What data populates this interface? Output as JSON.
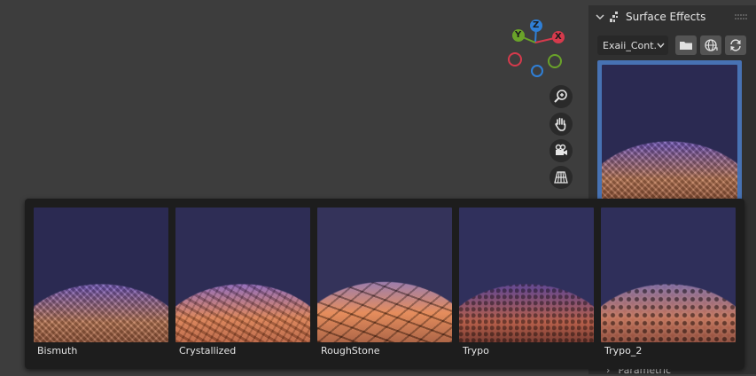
{
  "gizmo": {
    "z_label": "Z",
    "y_label": "Y",
    "x_label": "X",
    "colors": {
      "z": "#2f7fd6",
      "y": "#6aa329",
      "x": "#d63a4c"
    }
  },
  "view_tools": [
    {
      "name": "zoom-icon"
    },
    {
      "name": "pan-hand-icon"
    },
    {
      "name": "camera-icon"
    },
    {
      "name": "perspective-grid-icon"
    }
  ],
  "panel": {
    "title": "Surface Effects",
    "library_dropdown": "Exaii_Cont...",
    "section_below": "Parametric",
    "accent": "#4772b3"
  },
  "popup": {
    "items": [
      {
        "label": "Bismuth"
      },
      {
        "label": "Crystallized"
      },
      {
        "label": "RoughStone"
      },
      {
        "label": "Trypo"
      },
      {
        "label": "Trypo_2"
      }
    ]
  }
}
